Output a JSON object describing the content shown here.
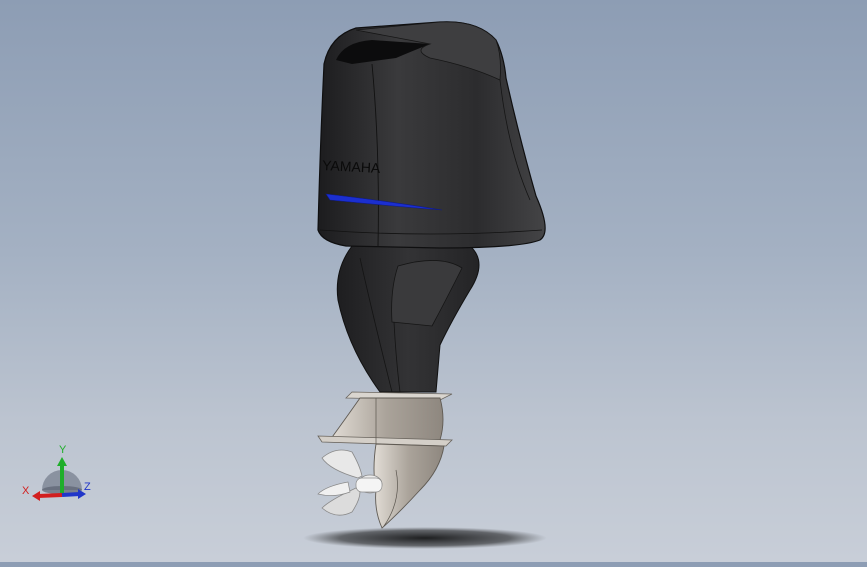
{
  "model": {
    "brand_text": "YAMAHA",
    "cowling_color": "#2a2a2c",
    "stripe_color": "#1b2fd0",
    "lower_unit_color": "#b9b3ab",
    "propeller_color": "#e6e6e6"
  },
  "triad": {
    "x_label": "X",
    "y_label": "Y",
    "z_label": "Z",
    "x_color": "#d21f1f",
    "y_color": "#1fae2a",
    "z_color": "#2036c9"
  }
}
